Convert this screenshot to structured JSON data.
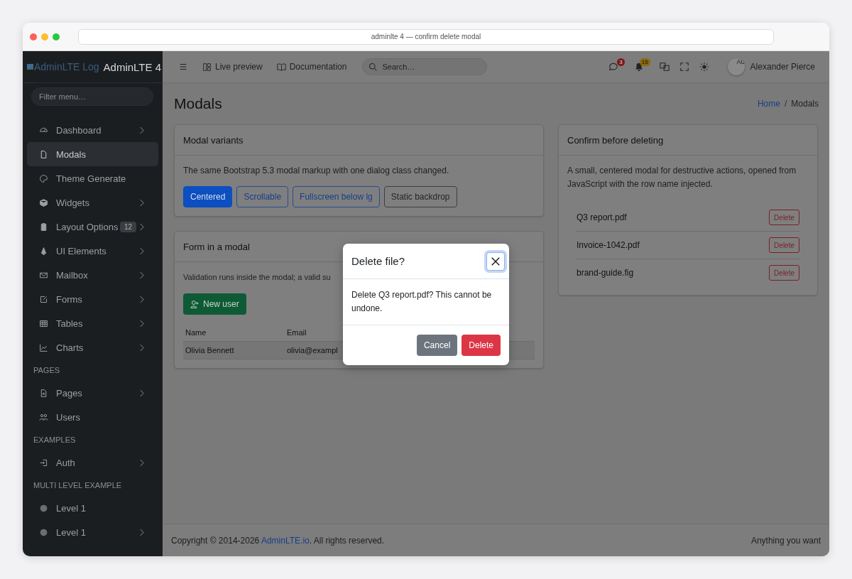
{
  "browser": {
    "address": "adminlte 4 — confirm delete modal"
  },
  "sidebar": {
    "brand_logo_alt": "AdminLTE Log",
    "brand": "AdminLTE 4",
    "filter_placeholder": "Filter menu…",
    "entries": [
      {
        "kind": "item",
        "label": "Dashboard",
        "has_submenu": true,
        "selected": false
      },
      {
        "kind": "item",
        "label": "Modals",
        "has_submenu": false,
        "selected": true
      },
      {
        "kind": "item",
        "label": "Theme Generate",
        "has_submenu": false,
        "selected": false
      },
      {
        "kind": "item",
        "label": "Widgets",
        "has_submenu": true,
        "selected": false
      },
      {
        "kind": "item",
        "label": "Layout Options",
        "has_submenu": true,
        "selected": false,
        "badge": "12"
      },
      {
        "kind": "item",
        "label": "UI Elements",
        "has_submenu": true,
        "selected": false
      },
      {
        "kind": "item",
        "label": "Mailbox",
        "has_submenu": true,
        "selected": false
      },
      {
        "kind": "item",
        "label": "Forms",
        "has_submenu": true,
        "selected": false
      },
      {
        "kind": "item",
        "label": "Tables",
        "has_submenu": true,
        "selected": false
      },
      {
        "kind": "item",
        "label": "Charts",
        "has_submenu": true,
        "selected": false
      },
      {
        "kind": "header",
        "label": "PAGES"
      },
      {
        "kind": "item",
        "label": "Pages",
        "has_submenu": true,
        "selected": false
      },
      {
        "kind": "item",
        "label": "Users",
        "has_submenu": false,
        "selected": false
      },
      {
        "kind": "header",
        "label": "EXAMPLES"
      },
      {
        "kind": "item",
        "label": "Auth",
        "has_submenu": true,
        "selected": false
      },
      {
        "kind": "header",
        "label": "MULTI LEVEL EXAMPLE"
      },
      {
        "kind": "item",
        "label": "Level 1",
        "has_submenu": false,
        "selected": false
      },
      {
        "kind": "item",
        "label": "Level 1",
        "has_submenu": true,
        "selected": false
      }
    ]
  },
  "topbar": {
    "nav_links": [
      "Live preview",
      "Documentation"
    ],
    "search_placeholder": "Search…",
    "messages_badge": "3",
    "notifications_badge": "15",
    "avatar_alt": "Au",
    "user_name": "Alexander Pierce"
  },
  "page": {
    "title": "Modals",
    "breadcrumb_separator": "/",
    "breadcrumb": [
      {
        "label": "Home",
        "link": true
      },
      {
        "label": "Modals",
        "link": false
      }
    ]
  },
  "variants_card": {
    "title": "Modal variants",
    "text": "The same Bootstrap 5.3 modal markup with one dialog class changed.",
    "buttons": [
      {
        "label": "Centered",
        "kind": "primary"
      },
      {
        "label": "Scrollable",
        "kind": "outline-primary"
      },
      {
        "label": "Fullscreen below lg",
        "kind": "outline-primary"
      },
      {
        "label": "Static backdrop",
        "kind": "outline-secondary"
      }
    ]
  },
  "form_card": {
    "title": "Form in a modal",
    "text": "Validation runs inside the modal; a valid su",
    "button": "New user",
    "table": {
      "columns": [
        "Name",
        "Email"
      ],
      "rows": [
        [
          "Olivia Bennett",
          "olivia@exampl"
        ]
      ]
    }
  },
  "confirm_card": {
    "title": "Confirm before deleting",
    "text": "A small, centered modal for destructive actions, opened from JavaScript with the row name injected.",
    "files": [
      {
        "name": "Q3 report.pdf",
        "action": "Delete"
      },
      {
        "name": "Invoice-1042.pdf",
        "action": "Delete"
      },
      {
        "name": "brand-guide.fig",
        "action": "Delete"
      }
    ]
  },
  "footer": {
    "text_before": "Copyright © 2014-2026 ",
    "link": "AdminLTE.io",
    "text_after": ". All rights reserved.",
    "right": "Anything you want"
  },
  "modal": {
    "title": "Delete file?",
    "close_focused": true,
    "text": "Delete Q3 report.pdf? This cannot be undone.",
    "buttons": [
      {
        "label": "Cancel",
        "kind": "secondary"
      },
      {
        "label": "Delete",
        "kind": "danger"
      }
    ]
  }
}
